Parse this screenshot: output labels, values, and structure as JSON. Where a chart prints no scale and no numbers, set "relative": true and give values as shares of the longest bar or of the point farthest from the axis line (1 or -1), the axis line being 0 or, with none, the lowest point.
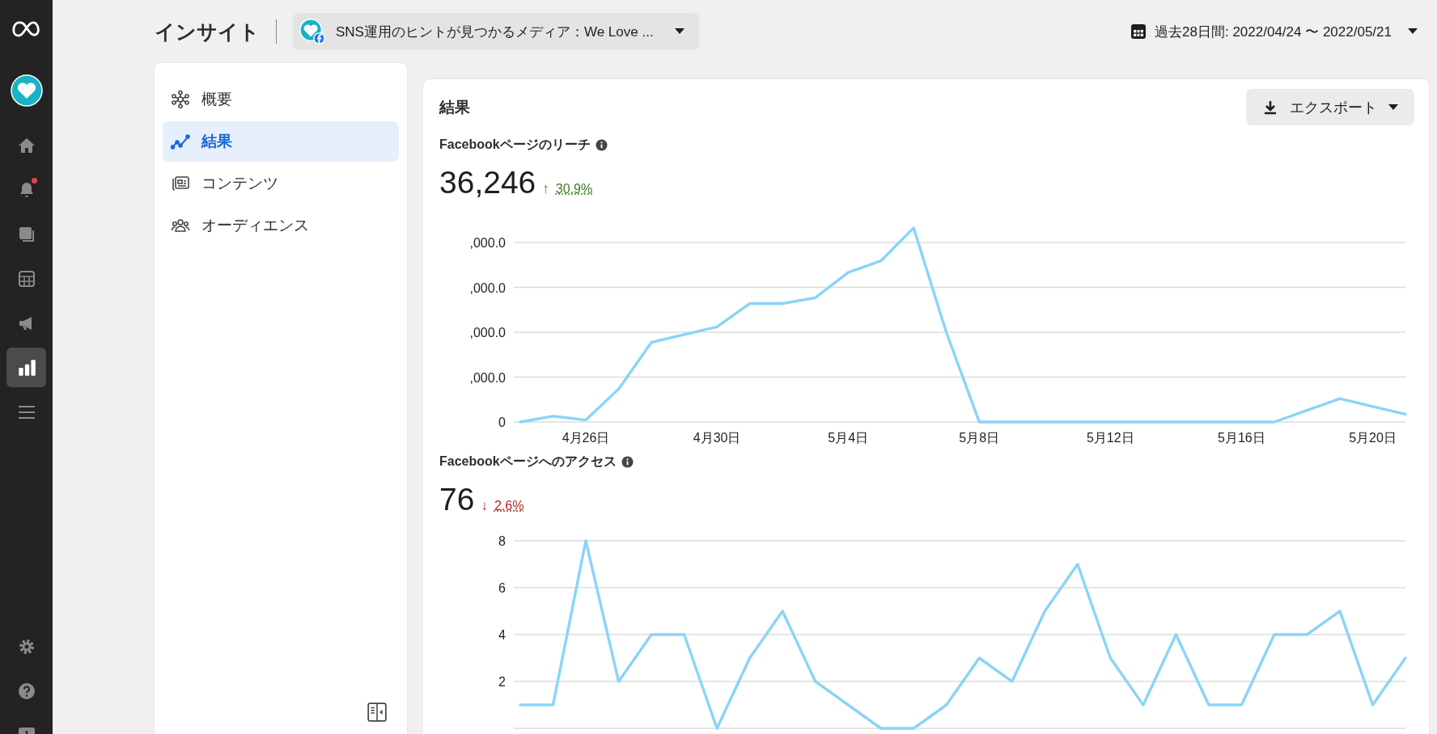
{
  "rail": {
    "top": [
      {
        "kind": "home",
        "selected": false,
        "badge": false
      },
      {
        "kind": "bell",
        "selected": false,
        "badge": true
      },
      {
        "kind": "pages",
        "selected": false,
        "badge": false
      },
      {
        "kind": "table",
        "selected": false,
        "badge": false
      },
      {
        "kind": "megaphone",
        "selected": false,
        "badge": false
      },
      {
        "kind": "chart",
        "selected": true,
        "badge": false
      },
      {
        "kind": "menu",
        "selected": false,
        "badge": false
      }
    ],
    "bottom": [
      {
        "kind": "gear",
        "selected": false,
        "badge": false
      },
      {
        "kind": "help",
        "selected": false,
        "badge": false
      },
      {
        "kind": "feedback",
        "selected": false,
        "badge": false
      }
    ]
  },
  "header": {
    "title": "インサイト",
    "page_selector": "SNS運用のヒントが見つかるメディア：We Love ...",
    "date_range": "過去28日間: 2022/04/24 〜 2022/05/21"
  },
  "nav": {
    "items": [
      {
        "label": "概要",
        "kind": "overview",
        "selected": false
      },
      {
        "label": "結果",
        "kind": "results",
        "selected": true
      },
      {
        "label": "コンテンツ",
        "kind": "content",
        "selected": false
      },
      {
        "label": "オーディエンス",
        "kind": "audience",
        "selected": false
      }
    ]
  },
  "content": {
    "heading": "結果",
    "export_button": "エクスポート",
    "metrics": [
      {
        "title": "Facebookページのリーチ",
        "value": "36,246",
        "arrow": "↑",
        "change": "30.9%",
        "color": "#3f7d20",
        "y_axis_labels": [
          ",000.0",
          ",000.0",
          ",000.0",
          ",000.0",
          "0"
        ],
        "chart_data": {
          "type": "line",
          "relative": true,
          "categories": [
            null,
            null,
            "4月26日",
            null,
            null,
            null,
            "4月30日",
            null,
            null,
            null,
            "5月4日",
            null,
            null,
            null,
            "5月8日",
            null,
            null,
            null,
            "5月12日",
            null,
            null,
            null,
            "5月16日",
            null,
            null,
            null,
            "5月20日",
            null
          ],
          "series": [
            {
              "color": "#8ad4f8",
              "values": [
                0,
                0.03,
                0.01,
                0.17,
                0.41,
                0.45,
                0.49,
                0.61,
                0.61,
                0.64,
                0.77,
                0.83,
                1,
                0.46,
                0,
                0,
                0,
                0,
                0,
                0,
                0,
                0,
                0,
                0,
                0.06,
                0.12,
                0.08,
                0.04
              ]
            }
          ]
        }
      },
      {
        "title": "Facebookページへのアクセス",
        "value": "76",
        "arrow": "↓",
        "change": "2.6%",
        "color": "#b3261e",
        "chart_data": {
          "type": "line",
          "grid": true,
          "ylim": [
            0,
            8
          ],
          "yticks": [
            2,
            4,
            6,
            8
          ],
          "series": [
            {
              "color": "#8ad4f8",
              "values": [
                1,
                1,
                8,
                2,
                4,
                4,
                0,
                3,
                5,
                2,
                1,
                0,
                0,
                1,
                3,
                2,
                5,
                7,
                3,
                1,
                4,
                1,
                1,
                4,
                4,
                5,
                1,
                3
              ]
            }
          ]
        }
      }
    ]
  }
}
